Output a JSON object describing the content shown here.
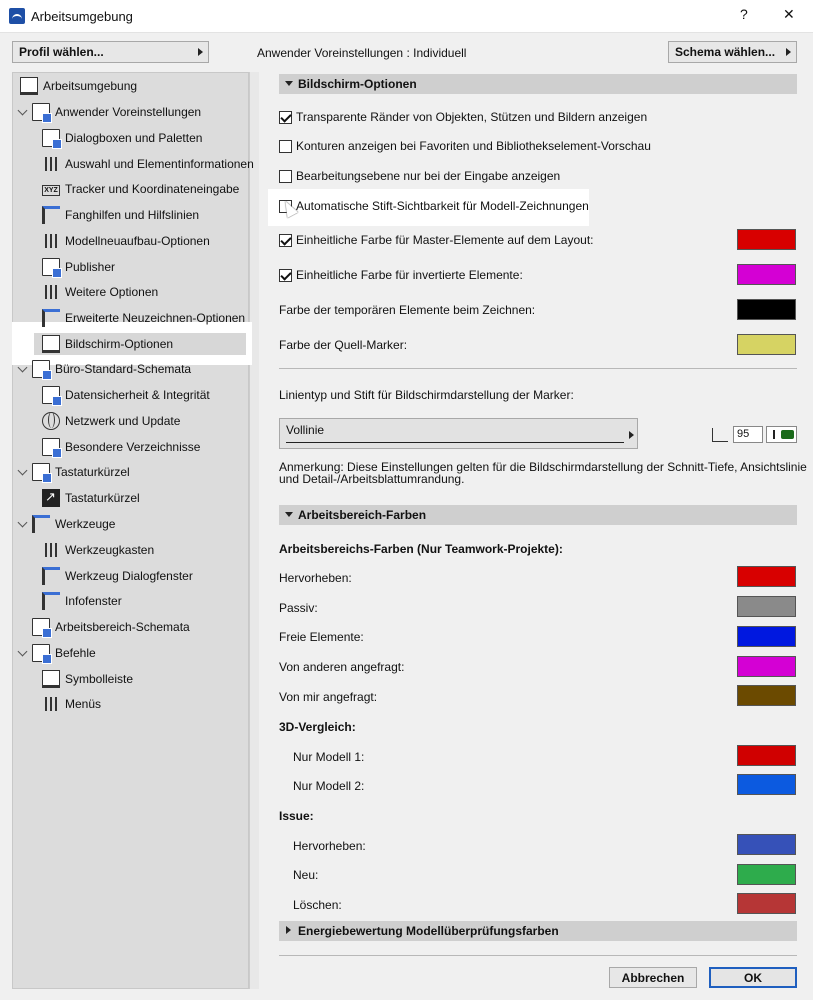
{
  "window": {
    "title": "Arbeitsumgebung",
    "help": "?",
    "close": "✕"
  },
  "toolbar": {
    "profile_label": "Profil wählen...",
    "user_prefs_label": "Anwender Voreinstellungen :  Individuell",
    "schema_label": "Schema wählen..."
  },
  "tree": [
    {
      "label": "Arbeitsumgebung",
      "level": 0,
      "icon": "monitor-icon"
    },
    {
      "label": "Anwender Voreinstellungen",
      "level": 0,
      "icon": "doc-icon",
      "expanded": true
    },
    {
      "label": "Dialogboxen und Paletten",
      "level": 1,
      "icon": "doc-icon"
    },
    {
      "label": "Auswahl und Elementinformationen",
      "level": 1,
      "icon": "info-icon"
    },
    {
      "label": "Tracker und Koordinateneingabe",
      "level": 1,
      "icon": "xyz-icon"
    },
    {
      "label": "Fanghilfen und Hilfslinien",
      "level": 1,
      "icon": "cursor-icon"
    },
    {
      "label": "Modellneuaufbau-Optionen",
      "level": 1,
      "icon": "wall-icon"
    },
    {
      "label": "Publisher",
      "level": 1,
      "icon": "doc-icon"
    },
    {
      "label": "Weitere Optionen",
      "level": 1,
      "icon": "sliders-icon"
    },
    {
      "label": "Erweiterte Neuzeichnen-Optionen",
      "level": 1,
      "icon": "house-icon"
    },
    {
      "label": "Bildschirm-Optionen",
      "level": 1,
      "icon": "monitor-icon",
      "selected": true
    },
    {
      "label": "Büro-Standard-Schemata",
      "level": 0,
      "icon": "doc-icon",
      "expanded": true
    },
    {
      "label": "Datensicherheit & Integrität",
      "level": 1,
      "icon": "doc-icon"
    },
    {
      "label": "Netzwerk und Update",
      "level": 1,
      "icon": "globe-icon"
    },
    {
      "label": "Besondere Verzeichnisse",
      "level": 1,
      "icon": "folder-icon"
    },
    {
      "label": "Tastaturkürzel",
      "level": 0,
      "icon": "doc-icon",
      "expanded": true
    },
    {
      "label": "Tastaturkürzel",
      "level": 1,
      "icon": "arrow-icon"
    },
    {
      "label": "Werkzeuge",
      "level": 0,
      "icon": "tool-icon",
      "expanded": true
    },
    {
      "label": "Werkzeugkasten",
      "level": 1,
      "icon": "toolbox-icon"
    },
    {
      "label": "Werkzeug Dialogfenster",
      "level": 1,
      "icon": "tool-icon"
    },
    {
      "label": "Infofenster",
      "level": 1,
      "icon": "tool-icon"
    },
    {
      "label": "Arbeitsbereich-Schemata",
      "level": 0,
      "icon": "doc-icon"
    },
    {
      "label": "Befehle",
      "level": 0,
      "icon": "doc-icon",
      "expanded": true
    },
    {
      "label": "Symbolleiste",
      "level": 1,
      "icon": "toolbar-icon"
    },
    {
      "label": "Menüs",
      "level": 1,
      "icon": "menu-icon"
    }
  ],
  "bildschirm": {
    "header": "Bildschirm-Optionen",
    "checkboxes": [
      {
        "label": "Transparente Ränder von Objekten, Stützen und Bildern anzeigen",
        "checked": true
      },
      {
        "label": "Konturen anzeigen bei Favoriten und Bibliothekselement-Vorschau",
        "checked": false
      },
      {
        "label": "Bearbeitungsebene nur bei der Eingabe anzeigen",
        "checked": false
      },
      {
        "label": "Automatische Stift-Sichtbarkeit für Modell-Zeichnungen",
        "checked": false
      },
      {
        "label": "Einheitliche Farbe für Master-Elemente auf dem Layout:",
        "checked": true,
        "color": "#d80000"
      },
      {
        "label": "Einheitliche Farbe für invertierte Elemente:",
        "checked": true,
        "color": "#d400d4"
      }
    ],
    "temp_label": "Farbe der temporären Elemente beim Zeichnen:",
    "temp_color": "#000000",
    "source_label": "Farbe der Quell-Marker:",
    "source_color": "#d6d363",
    "linetype_label": "Linientyp und Stift für Bildschirmdarstellung der Marker:",
    "linetype_value": "Vollinie",
    "pen_number": "95",
    "note": "Anmerkung: Diese Einstellungen gelten für die Bildschirmdarstellung der Schnitt-Tiefe, Ansichtslinie",
    "note2": "und Detail-/Arbeitsblattumrandung."
  },
  "arbeitsbereich": {
    "header": "Arbeitsbereich-Farben",
    "sub_header": "Arbeitsbereichs-Farben (Nur Teamwork-Projekte):",
    "rows": [
      {
        "label": "Hervorheben:",
        "color": "#d80000"
      },
      {
        "label": "Passiv:",
        "color": "#8a8a8a"
      },
      {
        "label": "Freie Elemente:",
        "color": "#0018e0"
      },
      {
        "label": "Von anderen angefragt:",
        "color": "#d400d4"
      },
      {
        "label": "Von mir angefragt:",
        "color": "#6b4a00"
      }
    ],
    "vergleich_header": "3D-Vergleich:",
    "vergleich": [
      {
        "label": "Nur Modell 1:",
        "color": "#d00000"
      },
      {
        "label": "Nur Modell 2:",
        "color": "#0c5ae0"
      }
    ],
    "issue_header": "Issue:",
    "issue": [
      {
        "label": "Hervorheben:",
        "color": "#3651b8"
      },
      {
        "label": "Neu:",
        "color": "#2eac4c"
      },
      {
        "label": "Löschen:",
        "color": "#b63636"
      }
    ]
  },
  "energie": {
    "header": "Energiebewertung Modellüberprüfungsfarben"
  },
  "buttons": {
    "cancel": "Abbrechen",
    "ok": "OK"
  }
}
